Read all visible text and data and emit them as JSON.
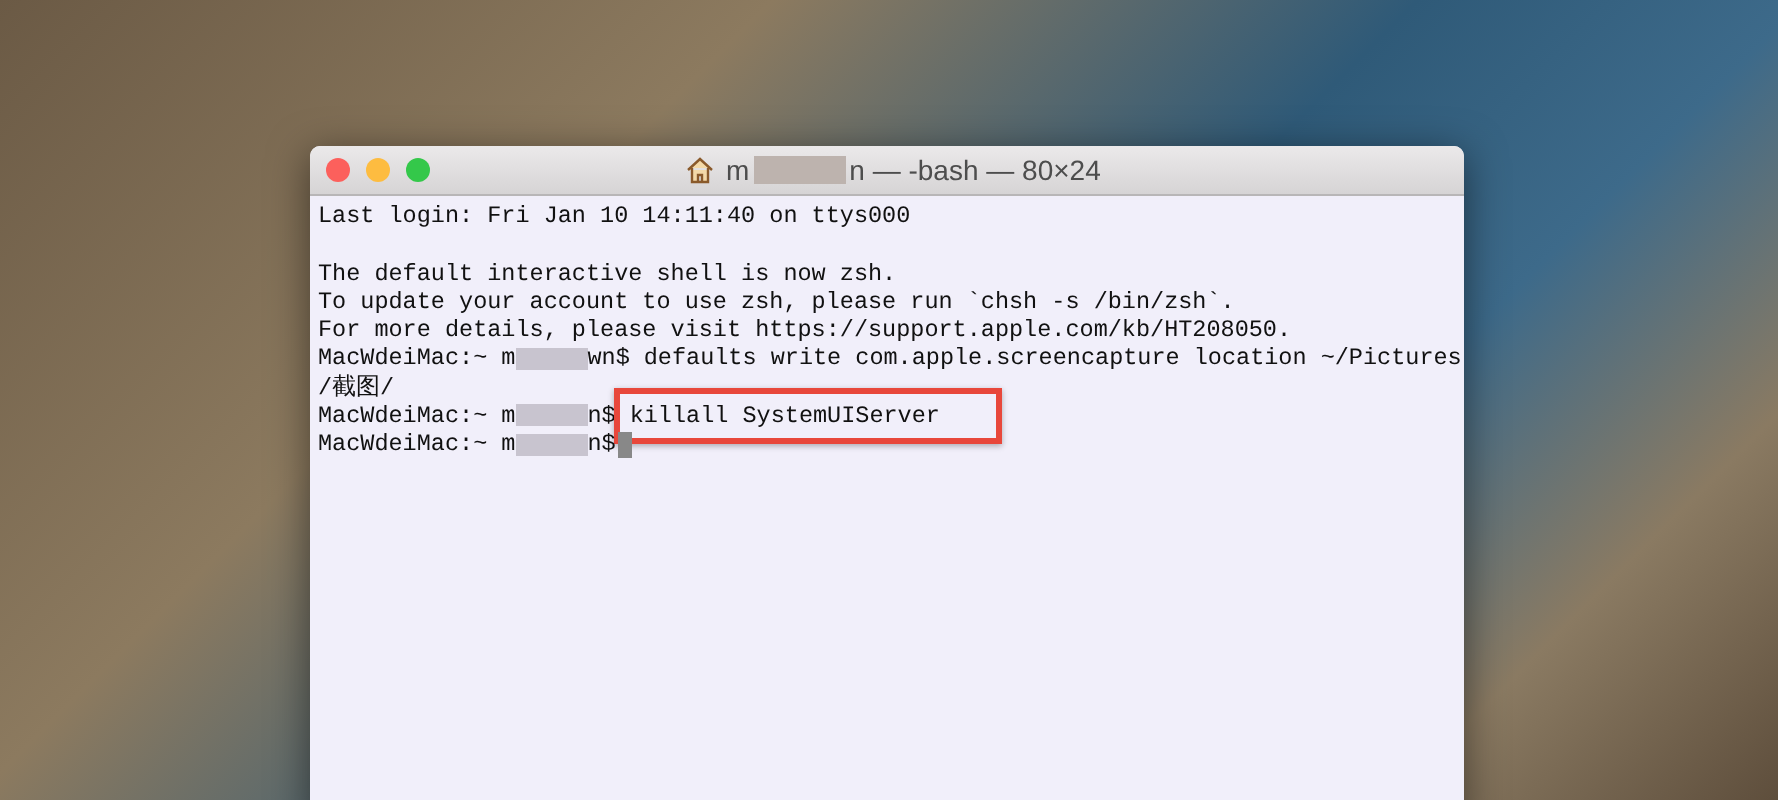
{
  "window": {
    "title_start": "m",
    "title_end": "n — -bash — 80×24"
  },
  "lines": [
    {
      "kind": "text",
      "text": "Last login: Fri Jan 10 14:11:40 on ttys000"
    },
    {
      "kind": "blank"
    },
    {
      "kind": "text",
      "text": "The default interactive shell is now zsh."
    },
    {
      "kind": "text",
      "text": "To update your account to use zsh, please run `chsh -s /bin/zsh`."
    },
    {
      "kind": "text",
      "text": "For more details, please visit https://support.apple.com/kb/HT208050."
    },
    {
      "kind": "prompt",
      "host": "MacWdeiMac:~",
      "user_start": "m",
      "user_end": "wn$",
      "command": "defaults write com.apple.screencapture location ~/Pictures",
      "highlighted": false,
      "cursor": false
    },
    {
      "kind": "text",
      "text": "/截图/"
    },
    {
      "kind": "prompt",
      "host": "MacWdeiMac:~",
      "user_start": "m",
      "user_end": "n$",
      "command": "killall SystemUIServer",
      "highlighted": true,
      "cursor": false
    },
    {
      "kind": "prompt",
      "host": "MacWdeiMac:~",
      "user_start": "m",
      "user_end": "n$",
      "highlighted": false,
      "cursor": true
    }
  ]
}
